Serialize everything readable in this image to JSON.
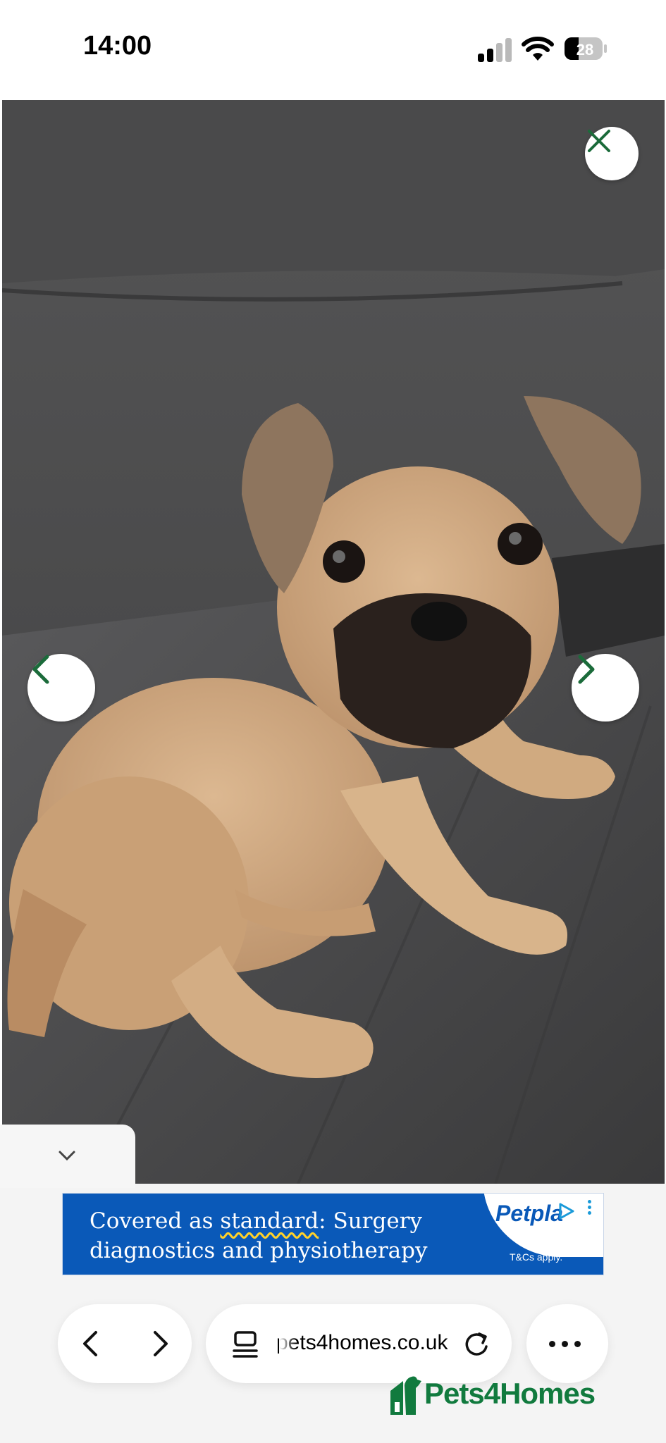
{
  "status_bar": {
    "time": "14:00",
    "battery": "28",
    "icons": [
      "cellular-signal-icon",
      "wifi-icon",
      "battery-icon"
    ]
  },
  "viewer": {
    "photo": "puppy-photo",
    "buttons": [
      "close-icon",
      "chevron-left-icon",
      "chevron-right-icon"
    ],
    "collapse_icon": "chevron-down-icon"
  },
  "ad": {
    "text_before": "Covered as ",
    "text_underlined": "standard",
    "text_after": ": Surgery diagnostics and physiotherapy",
    "brand": "Petplan",
    "terms": "T&Cs apply."
  },
  "browser": {
    "url": "pets4homes.co.uk",
    "icons": [
      "back-icon",
      "forward-icon",
      "tabs-icon",
      "reload-icon",
      "more-icon"
    ]
  },
  "site_logo": {
    "text": "Pets4Homes"
  },
  "colors": {
    "brand_green": "#117a3e",
    "ad_blue": "#0a59b8",
    "icon_green": "#1b6b3a"
  }
}
